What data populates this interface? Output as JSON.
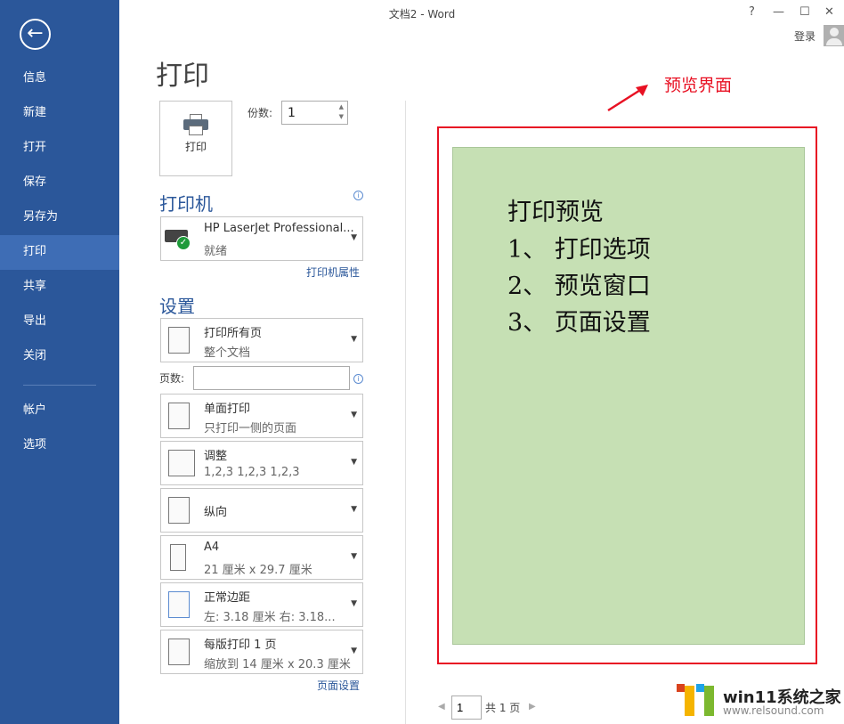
{
  "window": {
    "title": "文档2 - Word",
    "help": "?",
    "minimize": "—",
    "maximize": "☐",
    "close": "✕",
    "signin": "登录"
  },
  "sidebar": {
    "back": "←",
    "items": [
      {
        "label": "信息"
      },
      {
        "label": "新建"
      },
      {
        "label": "打开"
      },
      {
        "label": "保存"
      },
      {
        "label": "另存为"
      },
      {
        "label": "打印",
        "selected": true
      },
      {
        "label": "共享"
      },
      {
        "label": "导出"
      },
      {
        "label": "关闭"
      }
    ],
    "bottom_items": [
      {
        "label": "帐户"
      },
      {
        "label": "选项"
      }
    ]
  },
  "print": {
    "title": "打印",
    "print_button": "打印",
    "copies_label": "份数:",
    "copies_value": "1"
  },
  "printer": {
    "heading": "打印机",
    "name": "HP LaserJet Professional...",
    "status": "就绪",
    "properties_link": "打印机属性"
  },
  "settings": {
    "heading": "设置",
    "pages_label": "页数:",
    "pages_value": "",
    "page_setup_link": "页面设置",
    "options": [
      {
        "line1": "打印所有页",
        "line2": "整个文档"
      },
      {
        "line1": "单面打印",
        "line2": "只打印一侧的页面"
      },
      {
        "line1": "调整",
        "line2": "1,2,3    1,2,3    1,2,3"
      },
      {
        "line1": "纵向",
        "line2": ""
      },
      {
        "line1": "A4",
        "line2": "21 厘米 x 29.7 厘米"
      },
      {
        "line1": "正常边距",
        "line2": "左: 3.18 厘米    右: 3.18..."
      },
      {
        "line1": "每版打印 1 页",
        "line2": "缩放到 14 厘米 x 20.3 厘米"
      }
    ]
  },
  "annotation": {
    "label": "预览界面",
    "color": "#e81123"
  },
  "preview": {
    "lines": [
      "打印预览",
      "1、 打印选项",
      "2、 预览窗口",
      "3、 页面设置"
    ],
    "page_color": "#c6e0b4"
  },
  "pager": {
    "current": "1",
    "total": "共 1 页"
  },
  "watermark": {
    "title": "win11系统之家",
    "url": "www.relsound.com"
  },
  "colors": {
    "sidebar": "#2b579a",
    "selected": "#3e6db5"
  }
}
